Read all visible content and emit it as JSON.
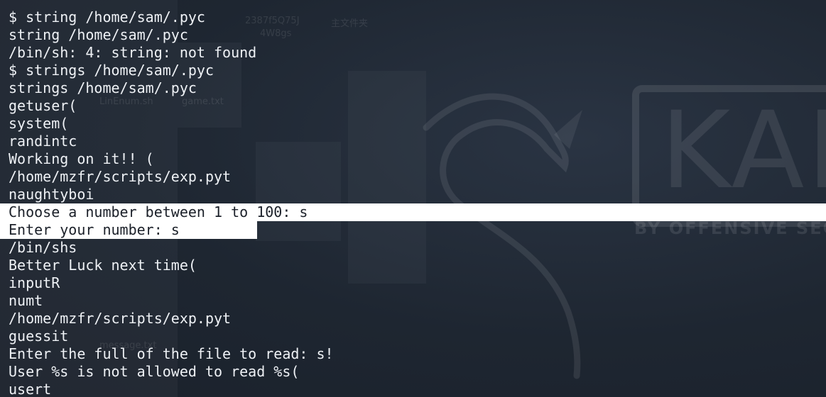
{
  "colors": {
    "background": "#1f2733",
    "text": "#eef1f5",
    "selection_bg": "#ffffff",
    "selection_text": "#1b2029"
  },
  "wallpaper": {
    "logo_text": "KAL",
    "tagline": "BY OFFENSIVE SECU",
    "desktop_labels": [
      "2387f5Q75J",
      "主文件夹",
      "4W8gs",
      "LinEnum.sh",
      "game.txt",
      "message.txt"
    ]
  },
  "terminal": {
    "lines": [
      "$ string /home/sam/.pyc",
      "string /home/sam/.pyc",
      "/bin/sh: 4: string: not found",
      "$ strings /home/sam/.pyc",
      "strings /home/sam/.pyc",
      "getuser(",
      "system(",
      "randintc",
      "Working on it!! (",
      "/home/mzfr/scripts/exp.pyt",
      "naughtyboi",
      "Choose a number between 1 to 100: s",
      "Enter your number: s",
      "/bin/shs",
      "Better Luck next time(",
      "inputR",
      "numt",
      "/home/mzfr/scripts/exp.pyt",
      "guessit",
      "Enter the full of the file to read: s!",
      "User %s is not allowed to read %s(",
      "usert"
    ]
  }
}
